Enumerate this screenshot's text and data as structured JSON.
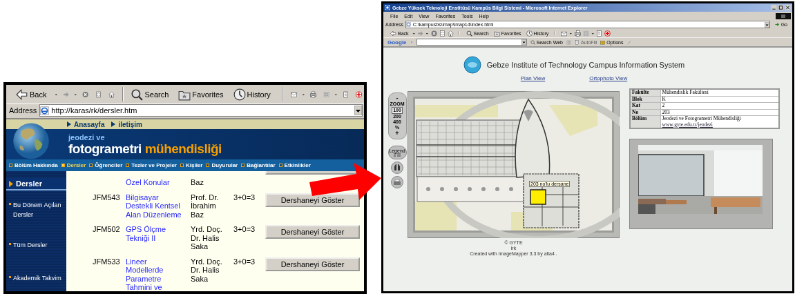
{
  "left_window": {
    "toolbar": [
      {
        "kind": "back",
        "label": "Back",
        "dropdown": true
      },
      {
        "kind": "forward",
        "dropdown": true
      },
      {
        "kind": "stop"
      },
      {
        "kind": "refresh"
      },
      {
        "kind": "home"
      },
      {
        "kind": "separator"
      },
      {
        "kind": "search",
        "label": "Search"
      },
      {
        "kind": "favorites",
        "label": "Favorites"
      },
      {
        "kind": "history",
        "label": "History"
      },
      {
        "kind": "separator"
      },
      {
        "kind": "mail",
        "dropdown": true
      },
      {
        "kind": "print"
      },
      {
        "kind": "discuss",
        "dropdown": true
      },
      {
        "kind": "edit"
      },
      {
        "kind": "plus"
      }
    ],
    "address_label": "Address",
    "address": "http://karas/rk/dersler.htm",
    "top_links": [
      "Anasayfa",
      "iletişim"
    ],
    "banner": {
      "line1": "jeodezi ve",
      "line2": "fotogrametri",
      "line2_accent": "mühendisliği"
    },
    "nav": [
      {
        "label": "Bölüm Hakkında",
        "selected": false
      },
      {
        "label": "Dersler",
        "selected": true
      },
      {
        "label": "Öğrenciler",
        "selected": false
      },
      {
        "label": "Tezler ve Projeler",
        "selected": false
      },
      {
        "label": "Kişiler",
        "selected": false
      },
      {
        "label": "Duyurular",
        "selected": false
      },
      {
        "label": "Bağlantılar",
        "selected": false
      },
      {
        "label": "Etkinlikler",
        "selected": false
      }
    ],
    "sidebar": {
      "heading": "Dersler",
      "items": [
        "Bu Dönem Açılan Dersler",
        "Tüm Dersler",
        "Akademik Takvim"
      ]
    },
    "courses": [
      {
        "kind": "partial",
        "name": "Özel Konular",
        "instructor": "Baz"
      },
      {
        "kind": "full",
        "code": "JFM543",
        "name": "Bilgisayar Destekli Kentsel Alan Düzenleme",
        "instructor": "Prof. Dr. İbrahim Baz",
        "credits": "3+0=3",
        "button": "Dershaneyi Göster"
      },
      {
        "kind": "full",
        "code": "JFM502",
        "name": "GPS Ölçme Tekniği II",
        "instructor": "Yrd. Doç. Dr. Halis Saka",
        "credits": "3+0=3",
        "button": "Dershaneyi Göster"
      },
      {
        "kind": "full",
        "code": "JFM533",
        "name": "Lineer Modellerde Parametre Tahmini ve",
        "instructor": "Yrd. Doç. Dr. Halis Saka",
        "credits": "3+0=3",
        "button": "Dershaneyi Göster"
      }
    ]
  },
  "right_window": {
    "title": "Gebze Yüksek Teknoloji Enstitüsü Kampüs Bilgi Sistemi - Microsoft Internet Explorer",
    "menu": [
      "File",
      "Edit",
      "View",
      "Favorites",
      "Tools",
      "Help"
    ],
    "address_label": "Address",
    "address": "C:\\kampusbs\\imap\\imap14\\index.html",
    "go": "Go",
    "toolbar": [
      {
        "kind": "back",
        "label": "Back",
        "dropdown": true
      },
      {
        "kind": "forward",
        "dropdown": true
      },
      {
        "kind": "stop"
      },
      {
        "kind": "refresh"
      },
      {
        "kind": "home"
      },
      {
        "kind": "separator"
      },
      {
        "kind": "search",
        "label": "Search"
      },
      {
        "kind": "favorites",
        "label": "Favorites"
      },
      {
        "kind": "history",
        "label": "History"
      },
      {
        "kind": "separator"
      },
      {
        "kind": "mail",
        "dropdown": true
      },
      {
        "kind": "print"
      },
      {
        "kind": "discuss",
        "dropdown": true
      },
      {
        "kind": "edit"
      },
      {
        "kind": "plus"
      }
    ],
    "google": {
      "logo": "Google",
      "search": "Search Web",
      "autofill": "AutoFill",
      "options": "Options"
    },
    "page": {
      "title": "Gebze Institute of Technology Campus Information System",
      "links": [
        "Plan View",
        "Ortophoto View"
      ],
      "zoom": {
        "minus": "-",
        "label": "ZOOM",
        "levels": [
          {
            "label": "100",
            "selected": true
          },
          {
            "label": "200",
            "selected": false
          },
          {
            "label": "400",
            "selected": false
          }
        ],
        "unit": "%",
        "plus": "+"
      },
      "legend": "Legend",
      "tooltip": "203 no'lu dersane",
      "info": [
        {
          "key": "Fakülte",
          "value": "Mühendislik Fakültesi"
        },
        {
          "key": "Blok",
          "value": "K"
        },
        {
          "key": "Kat",
          "value": "2"
        },
        {
          "key": "No",
          "value": "203"
        },
        {
          "key": "Bölüm",
          "value": "Jeodezi ve Fotogrametri Mühendisliği",
          "link": "www.gyte.edu.tr/jeodezi"
        }
      ],
      "footer": [
        "© GYTE",
        "irk",
        "Created with ImageMapper 3.3 by alta4 ."
      ]
    }
  }
}
